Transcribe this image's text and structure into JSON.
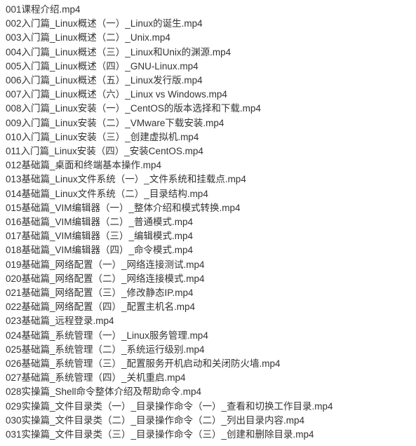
{
  "files": [
    "001课程介绍.mp4",
    "002入门篇_Linux概述（一）_Linux的诞生.mp4",
    "003入门篇_Linux概述（二）_Unix.mp4",
    "004入门篇_Linux概述（三）_Linux和Unix的渊源.mp4",
    "005入门篇_Linux概述（四）_GNU-Linux.mp4",
    "006入门篇_Linux概述（五）_Linux发行版.mp4",
    "007入门篇_Linux概述（六）_Linux vs Windows.mp4",
    "008入门篇_Linux安装（一）_CentOS的版本选择和下载.mp4",
    "009入门篇_Linux安装（二）_VMware下载安装.mp4",
    "010入门篇_Linux安装（三）_创建虚拟机.mp4",
    "011入门篇_Linux安装（四）_安装CentOS.mp4",
    "012基础篇_桌面和终端基本操作.mp4",
    "013基础篇_Linux文件系统（一）_文件系统和挂载点.mp4",
    "014基础篇_Linux文件系统（二）_目录结构.mp4",
    "015基础篇_VIM编辑器（一）_整体介绍和模式转换.mp4",
    "016基础篇_VIM编辑器（二）_普通模式.mp4",
    "017基础篇_VIM编辑器（三）_编辑模式.mp4",
    "018基础篇_VIM编辑器（四）_命令模式.mp4",
    "019基础篇_网络配置（一）_网络连接测试.mp4",
    "020基础篇_网络配置（二）_网络连接模式.mp4",
    "021基础篇_网络配置（三）_修改静态IP.mp4",
    "022基础篇_网络配置（四）_配置主机名.mp4",
    "023基础篇_远程登录.mp4",
    "024基础篇_系统管理（一）_Linux服务管理.mp4",
    "025基础篇_系统管理（二）_系统运行级别.mp4",
    "026基础篇_系统管理（三）_配置服务开机启动和关闭防火墙.mp4",
    "027基础篇_系统管理（四）_关机重启.mp4",
    "028实操篇_Shell命令整体介绍及帮助命令.mp4",
    "029实操篇_文件目录类（一）_目录操作命令（一）_查看和切换工作目录.mp4",
    "030实操篇_文件目录类（二）_目录操作命令（二）_列出目录内容.mp4",
    "031实操篇_文件目录类（三）_目录操作命令（三）_创建和删除目录.mp4"
  ]
}
